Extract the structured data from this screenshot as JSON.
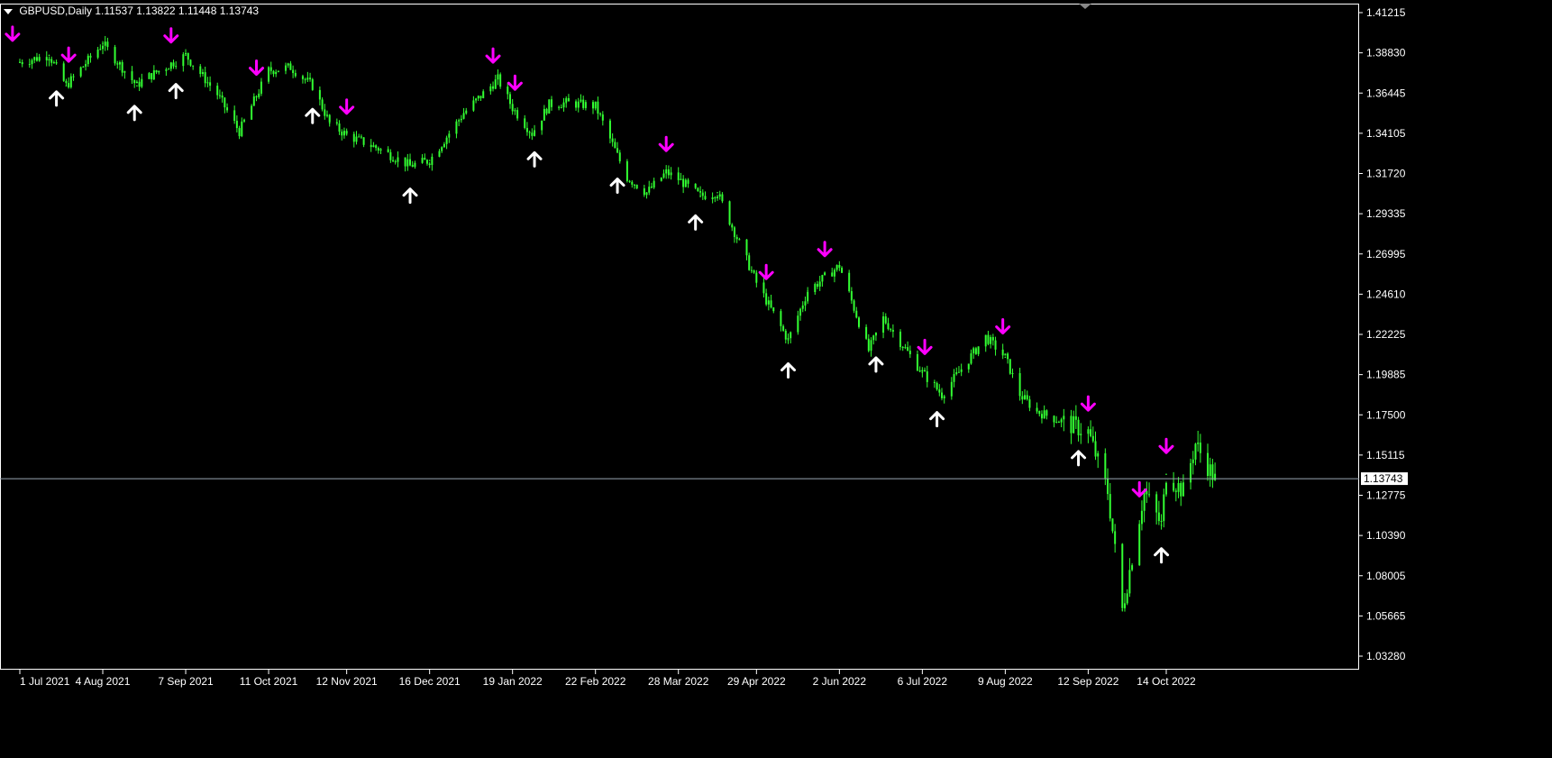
{
  "header": {
    "symbol_label": "GBPUSD,Daily",
    "ohlc": "1.11537 1.13822 1.11448 1.13743"
  },
  "colors": {
    "background": "#000000",
    "candle": "#32ff32",
    "axis": "#ffffff",
    "sell_arrow": "#ff00ff",
    "buy_arrow": "#ffffff",
    "price_line": "#9aa6b2"
  },
  "chart_data": {
    "type": "line",
    "title": "GBPUSD,Daily",
    "y_ticks": [
      "1.41215",
      "1.38830",
      "1.36445",
      "1.34105",
      "1.31720",
      "1.29335",
      "1.26995",
      "1.24610",
      "1.22225",
      "1.19885",
      "1.17500",
      "1.15115",
      "1.12775",
      "1.10390",
      "1.08005",
      "1.05665",
      "1.03280"
    ],
    "ylim": [
      1.0328,
      1.41215
    ],
    "x_ticks": [
      "1 Jul 2021",
      "4 Aug 2021",
      "7 Sep 2021",
      "11 Oct 2021",
      "12 Nov 2021",
      "16 Dec 2021",
      "19 Jan 2022",
      "22 Feb 2022",
      "28 Mar 2022",
      "29 Apr 2022",
      "2 Jun 2022",
      "6 Jul 2022",
      "9 Aug 2022",
      "12 Sep 2022",
      "14 Oct 2022"
    ],
    "current_price": "1.13743",
    "series": [
      {
        "x": [
          "1 Jul 2021",
          "13 Jul 2021",
          "20 Jul 2021",
          "4 Aug 2021",
          "18 Aug 2021",
          "20 Aug 2021",
          "7 Sep 2021",
          "20 Sep 2021",
          "29 Sep 2021",
          "11 Oct 2021",
          "20 Oct 2021",
          "29 Oct 2021",
          "5 Nov 2021",
          "12 Nov 2021",
          "25 Nov 2021",
          "8 Dec 2021",
          "16 Dec 2021",
          "30 Dec 2021",
          "13 Jan 2022",
          "19 Jan 2022",
          "27 Jan 2022",
          "3 Feb 2022",
          "10 Feb 2022",
          "22 Feb 2022",
          "7 Mar 2022",
          "15 Mar 2022",
          "23 Mar 2022",
          "28 Mar 2022",
          "6 Apr 2022",
          "13 Apr 2022",
          "29 Apr 2022",
          "12 May 2022",
          "20 May 2022",
          "2 Jun 2022",
          "14 Jun 2022",
          "20 Jun 2022",
          "6 Jul 2022",
          "14 Jul 2022",
          "1 Aug 2022",
          "9 Aug 2022",
          "15 Aug 2022",
          "22 Aug 2022",
          "12 Sep 2022",
          "20 Sep 2022",
          "26 Sep 2022",
          "5 Oct 2022",
          "12 Oct 2022",
          "14 Oct 2022",
          "21 Oct 2022",
          "26 Oct 2022",
          "3 Nov 2022"
        ],
        "values": [
          1.383,
          1.387,
          1.369,
          1.394,
          1.369,
          1.372,
          1.387,
          1.364,
          1.342,
          1.378,
          1.38,
          1.369,
          1.347,
          1.34,
          1.332,
          1.322,
          1.325,
          1.353,
          1.373,
          1.356,
          1.341,
          1.358,
          1.359,
          1.357,
          1.315,
          1.306,
          1.318,
          1.314,
          1.304,
          1.306,
          1.253,
          1.219,
          1.248,
          1.263,
          1.213,
          1.232,
          1.2,
          1.187,
          1.221,
          1.209,
          1.187,
          1.177,
          1.165,
          1.13,
          1.06,
          1.13,
          1.11,
          1.14,
          1.13,
          1.158,
          1.137
        ]
      }
    ],
    "signals": {
      "sell_arrows_dates": [
        "28 Jun 2021",
        "21 Jul 2021",
        "1 Sep 2021",
        "6 Oct 2021",
        "12 Nov 2021",
        "11 Jan 2022",
        "20 Jan 2022",
        "23 Mar 2022",
        "3 May 2022",
        "27 May 2022",
        "7 Jul 2022",
        "8 Aug 2022",
        "12 Sep 2022",
        "3 Oct 2022",
        "14 Oct 2022"
      ],
      "buy_arrows_dates": [
        "16 Jul 2021",
        "17 Aug 2021",
        "3 Sep 2021",
        "29 Oct 2021",
        "8 Dec 2021",
        "28 Jan 2022",
        "3 Mar 2022",
        "4 Apr 2022",
        "12 May 2022",
        "17 Jun 2022",
        "12 Jul 2022",
        "8 Sep 2022",
        "12 Oct 2022"
      ]
    },
    "grid": false,
    "legend": "none"
  }
}
